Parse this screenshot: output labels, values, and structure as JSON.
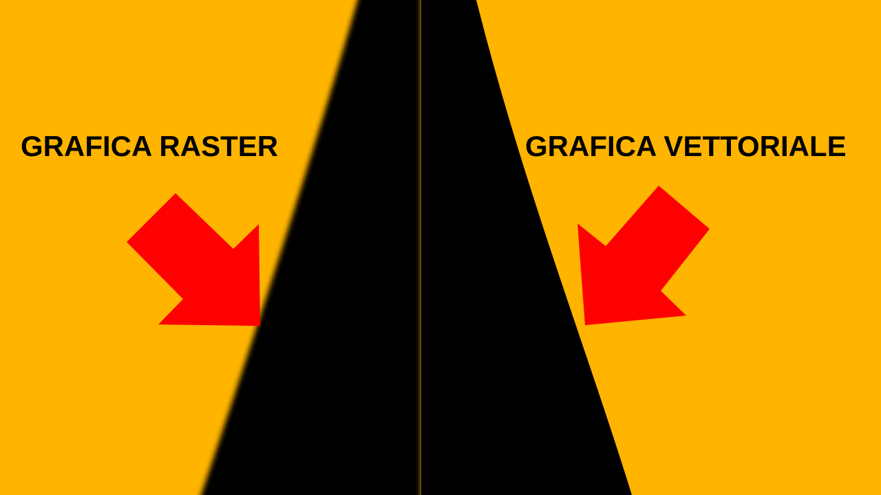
{
  "labels": {
    "raster": "GRAFICA RASTER",
    "vector": "GRAFICA VETTORIALE"
  },
  "colors": {
    "background": "#FFB400",
    "shape": "#000000",
    "arrow": "#FF0000",
    "text": "#000000"
  },
  "icons": {
    "left_arrow": "arrow-down-right-icon",
    "right_arrow": "arrow-down-left-icon"
  }
}
